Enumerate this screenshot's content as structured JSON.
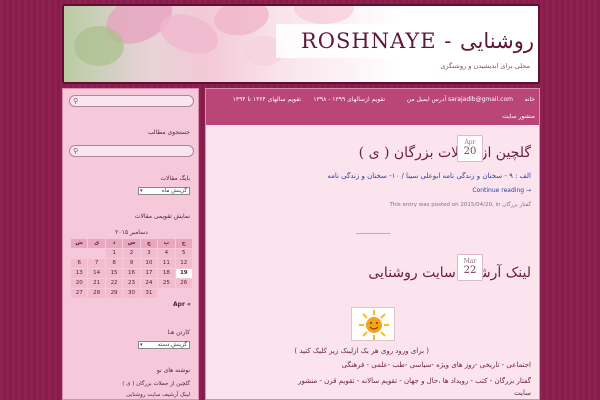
{
  "header": {
    "site_title": "ROSHNAYE - روشنایی",
    "tagline": "محلی برای اندیشیدن و روشنگری"
  },
  "sidebar": {
    "search_placeholder": "",
    "search_label": "جستجوی مطالب",
    "search2_placeholder": "",
    "archive_label": "بایگ مقالات",
    "archive_select": "گزینش ماه",
    "calendar_label": "نمایش تقویمی مقالات",
    "calendar_caption": "دسامبر ۲۰۱۵",
    "calendar_headers": [
      "ش",
      "ی",
      "د",
      "س",
      "چ",
      "پ",
      "ج"
    ],
    "calendar_days": [
      "",
      "",
      "1",
      "2",
      "3",
      "4",
      "5",
      "6",
      "7",
      "8",
      "9",
      "10",
      "11",
      "12",
      "13",
      "14",
      "15",
      "16",
      "17",
      "18",
      "19",
      "20",
      "21",
      "22",
      "23",
      "24",
      "25",
      "26",
      "27",
      "28",
      "29",
      "30",
      "31",
      "",
      ""
    ],
    "calendar_today": "19",
    "calendar_prev": "Apr «",
    "categories_label": "کارتن هـا",
    "categories_select": "گزینش دسته",
    "recent_label": "نوشته های نو",
    "recent_1": "گلچین از جملات بزرگان ( ی )",
    "recent_2": "لینک آرشیف سایت روشنایی"
  },
  "nav": {
    "item_1": "خانه",
    "item_2": "آدرس ایمیل من  sarajadib@gmail.com",
    "item_3": "تقویم ازسالهای ۱۳۹۹ - ۱۳۹۸",
    "item_4": "تقویم سالهای ۱۳۶۴ تا ۱۳۹۴",
    "item_5": "منشور سایت"
  },
  "post1": {
    "month": "Apr",
    "day": "20",
    "title": "گلچین از جملات بزرگان ( ی )",
    "link_text": "الف :  ۹ - سخنان و زندگی نامه ابوعلی سینا  /  ۱۰- سخنان و زندگی نامه",
    "continue": "Continue reading →",
    "meta": "This entry was posted on 2015/04/20, in   گفتار بزرگان"
  },
  "post2": {
    "month": "Mar",
    "day": "22",
    "title": "لینک آرشیف سایت روشنایی",
    "instruction": "( برای ورود روی هر یک ازلینک زیر کلیک کنید )",
    "line1": "اجتماعی   -   تاریخی   -روز های ویژه   -سیاسی   -طب   -علمی   - فرهنگی",
    "line2": "گفتار بزرگان - کتب  -  رویداد ها ،حال و جهان   -  تقویم سالانه   -  تقویم قرن -  منشور",
    "line3": "سایت"
  },
  "colors": {
    "background": "#8c1f4f",
    "sidebar": "#f5c8da",
    "nav": "#b94676",
    "content": "#fbe4ee",
    "link": "#2a3f9e"
  }
}
